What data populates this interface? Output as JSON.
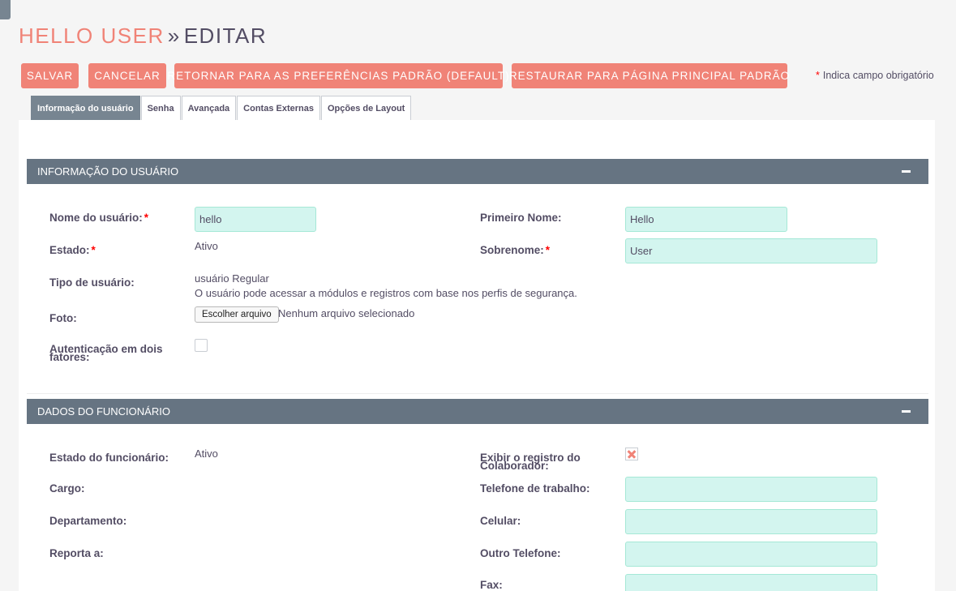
{
  "header": {
    "user_name": "HELLO USER",
    "separator": "»",
    "action": "EDITAR"
  },
  "toolbar": {
    "save_label": "SALVAR",
    "cancel_label": "CANCELAR",
    "reset_prefs_label": "RETORNAR PARA AS PREFERÊNCIAS PADRÃO (DEFAULT)",
    "restore_home_label": "RESTAURAR PARA PÁGINA PRINCIPAL PADRÃO"
  },
  "required_note": {
    "star": "*",
    "text": "Indica campo obrigatório"
  },
  "tabs": [
    {
      "label": "Informação do usuário",
      "active": true
    },
    {
      "label": "Senha",
      "active": false
    },
    {
      "label": "Avançada",
      "active": false
    },
    {
      "label": "Contas Externas",
      "active": false
    },
    {
      "label": "Opções de Layout",
      "active": false
    }
  ],
  "user_info": {
    "title": "INFORMAÇÃO DO USUÁRIO",
    "username_label": "Nome do usuário:",
    "username_value": "hello",
    "status_label": "Estado:",
    "status_value": "Ativo",
    "user_type_label": "Tipo de usuário:",
    "user_type_value": "usuário Regular",
    "user_type_desc": "O usuário pode acessar a módulos e registros com base nos perfis de segurança.",
    "photo_label": "Foto:",
    "photo_button": "Escolher arquivo",
    "photo_none": "Nenhum arquivo selecionado",
    "twofa_label_1": "Autenticação em dois",
    "twofa_label_2": "fatores:",
    "twofa_checked": false,
    "first_name_label": "Primeiro Nome:",
    "first_name_value": "Hello",
    "last_name_label": "Sobrenome:",
    "last_name_value": "User",
    "required_mark": "*"
  },
  "employee": {
    "title": "DADOS DO FUNCIONÁRIO",
    "emp_status_label": "Estado do funcionário:",
    "emp_status_value": "Ativo",
    "title_label": "Cargo:",
    "department_label": "Departamento:",
    "reports_to_label": "Reporta a:",
    "show_collab_label_1": "Exibir o registro do",
    "show_collab_label_2": "Colaborador:",
    "work_phone_label": "Telefone de trabalho:",
    "work_phone_value": "",
    "mobile_label": "Celular:",
    "mobile_value": "",
    "other_phone_label": "Outro Telefone:",
    "other_phone_value": "",
    "fax_label": "Fax:",
    "fax_value": ""
  },
  "colors": {
    "accent": "#f08377",
    "panel_header": "#667482",
    "input_bg": "#d3f5ef"
  }
}
